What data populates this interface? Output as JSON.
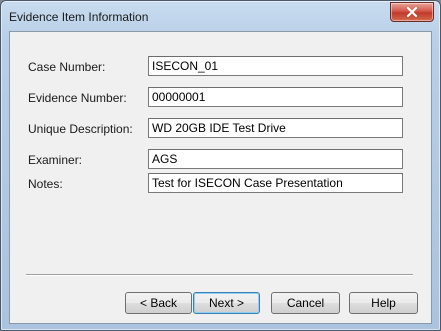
{
  "window": {
    "title": "Evidence Item Information"
  },
  "form": {
    "fields": [
      {
        "label": "Case Number:",
        "value": "ISECON_01"
      },
      {
        "label": "Evidence Number:",
        "value": "00000001"
      },
      {
        "label": "Unique Description:",
        "value": "WD 20GB IDE Test Drive"
      },
      {
        "label": "Examiner:",
        "value": "AGS"
      },
      {
        "label": "Notes:",
        "value": "Test for ISECON Case Presentation"
      }
    ]
  },
  "buttons": {
    "back": "< Back",
    "next": "Next >",
    "cancel": "Cancel",
    "help": "Help"
  },
  "icons": {
    "close": "close-icon"
  },
  "colors": {
    "close_button": "#c03a2b",
    "default_button_border": "#3c7fb1"
  }
}
